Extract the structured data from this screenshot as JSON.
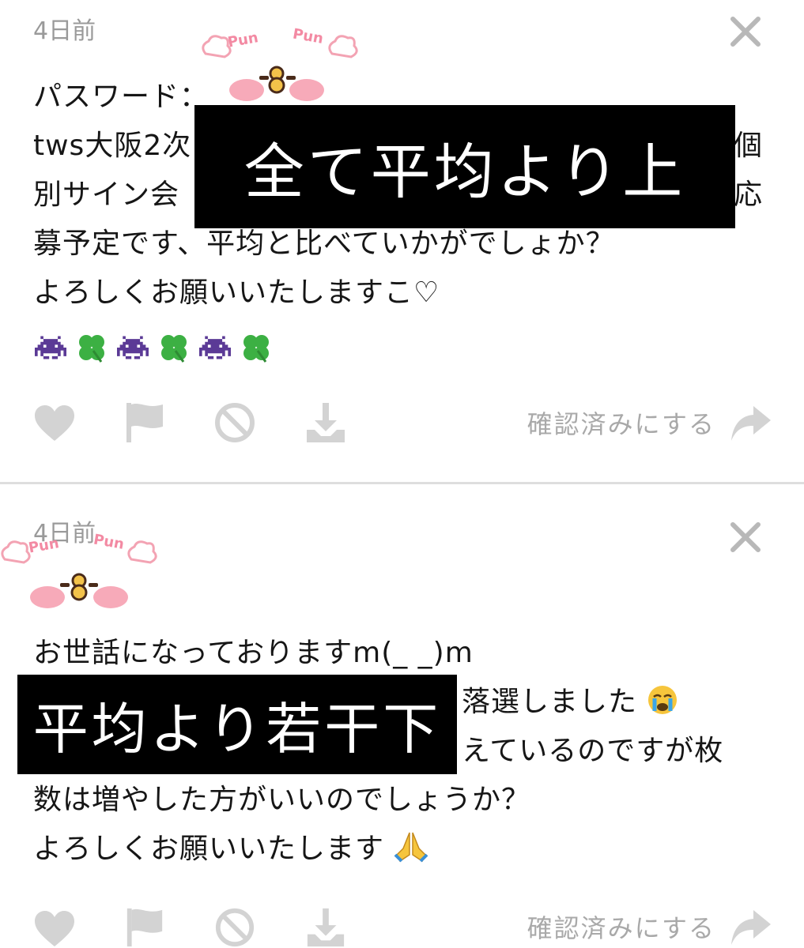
{
  "posts": [
    {
      "time": "4日前",
      "lines": [
        "パスワード：",
        "tws大阪2次",
        "個",
        "別サイン会",
        "応",
        "募予定です、平均と比べていかがでしょか？",
        "よろしくお願いいたしますこ♡"
      ],
      "overlay_text": "全て平均より上",
      "sticker_text": "Pun",
      "emoji_row": [
        "space-invader-icon",
        "clover-icon",
        "space-invader-icon",
        "clover-icon",
        "space-invader-icon",
        "clover-icon"
      ],
      "confirm_label": "確認済みにする"
    },
    {
      "time": "4日前",
      "lines": [
        "お世話になっておりますm(_ _)m",
        "落選しました",
        "えているのですが枚",
        "数は増やした方がいいのでしょうか？",
        "よろしくお願いいたします"
      ],
      "overlay_text": "平均より若干下",
      "sticker_text": "Pun",
      "confirm_label": "確認済みにする"
    }
  ],
  "colors": {
    "icon": "#d3d3d3",
    "close": "#b8b8b8",
    "meta": "#9a9a9a",
    "overlay": "#000000",
    "sticker_pink": "#f7a9b8",
    "invader": "#6a3d9a",
    "clover": "#3cb043"
  }
}
